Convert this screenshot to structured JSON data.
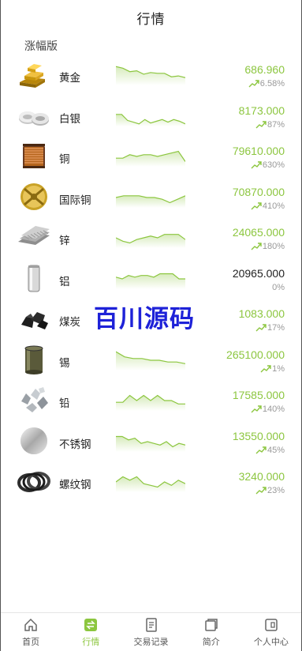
{
  "header": {
    "title": "行情"
  },
  "section": {
    "title": "涨幅版"
  },
  "colors": {
    "accent": "#8cc63f",
    "neutral": "#222222",
    "muted": "#999999",
    "watermark": "#1e22d8"
  },
  "items": [
    {
      "name": "黄金",
      "price": "686.960",
      "change": "6.58%",
      "icon": "gold-bar-icon",
      "trend": "up",
      "spark": [
        22,
        20,
        16,
        17,
        13,
        15,
        14,
        14,
        10,
        11,
        9
      ]
    },
    {
      "name": "白银",
      "price": "8173.000",
      "change": "87%",
      "icon": "silver-icon",
      "trend": "up",
      "spark": [
        14,
        14,
        7,
        5,
        3,
        8,
        4,
        6,
        8,
        5,
        8,
        6,
        3
      ]
    },
    {
      "name": "铜",
      "price": "79610.000",
      "change": "630%",
      "icon": "copper-coil-icon",
      "trend": "up",
      "spark": [
        10,
        10,
        14,
        12,
        14,
        14,
        12,
        14,
        16,
        18,
        6
      ]
    },
    {
      "name": "国际铜",
      "price": "70870.000",
      "change": "410%",
      "icon": "international-copper-icon",
      "trend": "up",
      "spark": [
        12,
        14,
        14,
        14,
        12,
        12,
        10,
        6,
        10,
        14
      ]
    },
    {
      "name": "锌",
      "price": "24065.000",
      "change": "180%",
      "icon": "zinc-sheets-icon",
      "trend": "up",
      "spark": [
        12,
        8,
        6,
        10,
        12,
        14,
        12,
        16,
        16,
        16,
        10
      ]
    },
    {
      "name": "铝",
      "price": "20965.000",
      "change": "0%",
      "icon": "aluminum-can-icon",
      "trend": "flat",
      "spark": [
        14,
        12,
        16,
        14,
        16,
        16,
        14,
        18,
        18,
        18,
        12,
        12
      ]
    },
    {
      "name": "煤炭",
      "price": "1083.000",
      "change": "17%",
      "icon": "coal-icon",
      "trend": "up",
      "spark": []
    },
    {
      "name": "锡",
      "price": "265100.000",
      "change": "1%",
      "icon": "tin-can-icon",
      "trend": "up",
      "spark": [
        22,
        16,
        14,
        14,
        12,
        12,
        10,
        10,
        8
      ]
    },
    {
      "name": "铅",
      "price": "17585.000",
      "change": "140%",
      "icon": "lead-chunks-icon",
      "trend": "up",
      "spark": [
        10,
        10,
        18,
        12,
        18,
        12,
        18,
        12,
        12,
        8,
        8
      ]
    },
    {
      "name": "不锈钢",
      "price": "13550.000",
      "change": "45%",
      "icon": "stainless-steel-icon",
      "trend": "up",
      "spark": [
        18,
        18,
        14,
        16,
        10,
        12,
        10,
        8,
        12,
        6,
        10,
        8
      ]
    },
    {
      "name": "螺纹钢",
      "price": "3240.000",
      "change": "23%",
      "icon": "rebar-coil-icon",
      "trend": "up",
      "spark": [
        12,
        18,
        14,
        18,
        10,
        8,
        6,
        12,
        8,
        14,
        10
      ]
    }
  ],
  "watermark": "百川源码",
  "tabbar": [
    {
      "label": "首页",
      "icon": "home-icon",
      "active": false
    },
    {
      "label": "行情",
      "icon": "exchange-icon",
      "active": true
    },
    {
      "label": "交易记录",
      "icon": "records-icon",
      "active": false
    },
    {
      "label": "简介",
      "icon": "intro-icon",
      "active": false
    },
    {
      "label": "个人中心",
      "icon": "profile-icon",
      "active": false
    }
  ]
}
